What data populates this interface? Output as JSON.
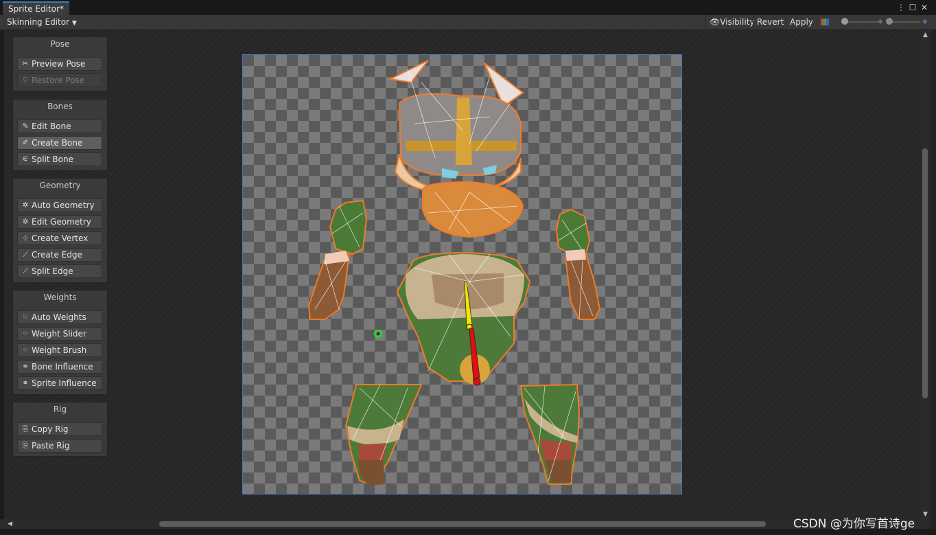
{
  "window": {
    "tab_title": "Sprite Editor*"
  },
  "toolbar": {
    "mode_dropdown": "Skinning Editor",
    "visibility_label": "Visibility",
    "revert_label": "Revert",
    "apply_label": "Apply"
  },
  "panels": {
    "pose": {
      "title": "Pose",
      "buttons": [
        "Preview Pose",
        "Restore Pose"
      ]
    },
    "bones": {
      "title": "Bones",
      "buttons": [
        "Edit Bone",
        "Create Bone",
        "Split Bone"
      ]
    },
    "geometry": {
      "title": "Geometry",
      "buttons": [
        "Auto Geometry",
        "Edit Geometry",
        "Create Vertex",
        "Create Edge",
        "Split Edge"
      ]
    },
    "weights": {
      "title": "Weights",
      "buttons": [
        "Auto Weights",
        "Weight Slider",
        "Weight Brush",
        "Bone Influence",
        "Sprite Influence"
      ]
    },
    "rig": {
      "title": "Rig",
      "buttons": [
        "Copy Rig",
        "Paste Rig"
      ]
    }
  },
  "watermark": "CSDN @为你写首诗ge",
  "colors": {
    "selection_outline": "#f07a2a",
    "bone_parent": "#f2e600",
    "bone_child": "#e01010",
    "canvas_border": "#4a78c8",
    "active_tab_accent": "#3a79bb"
  }
}
